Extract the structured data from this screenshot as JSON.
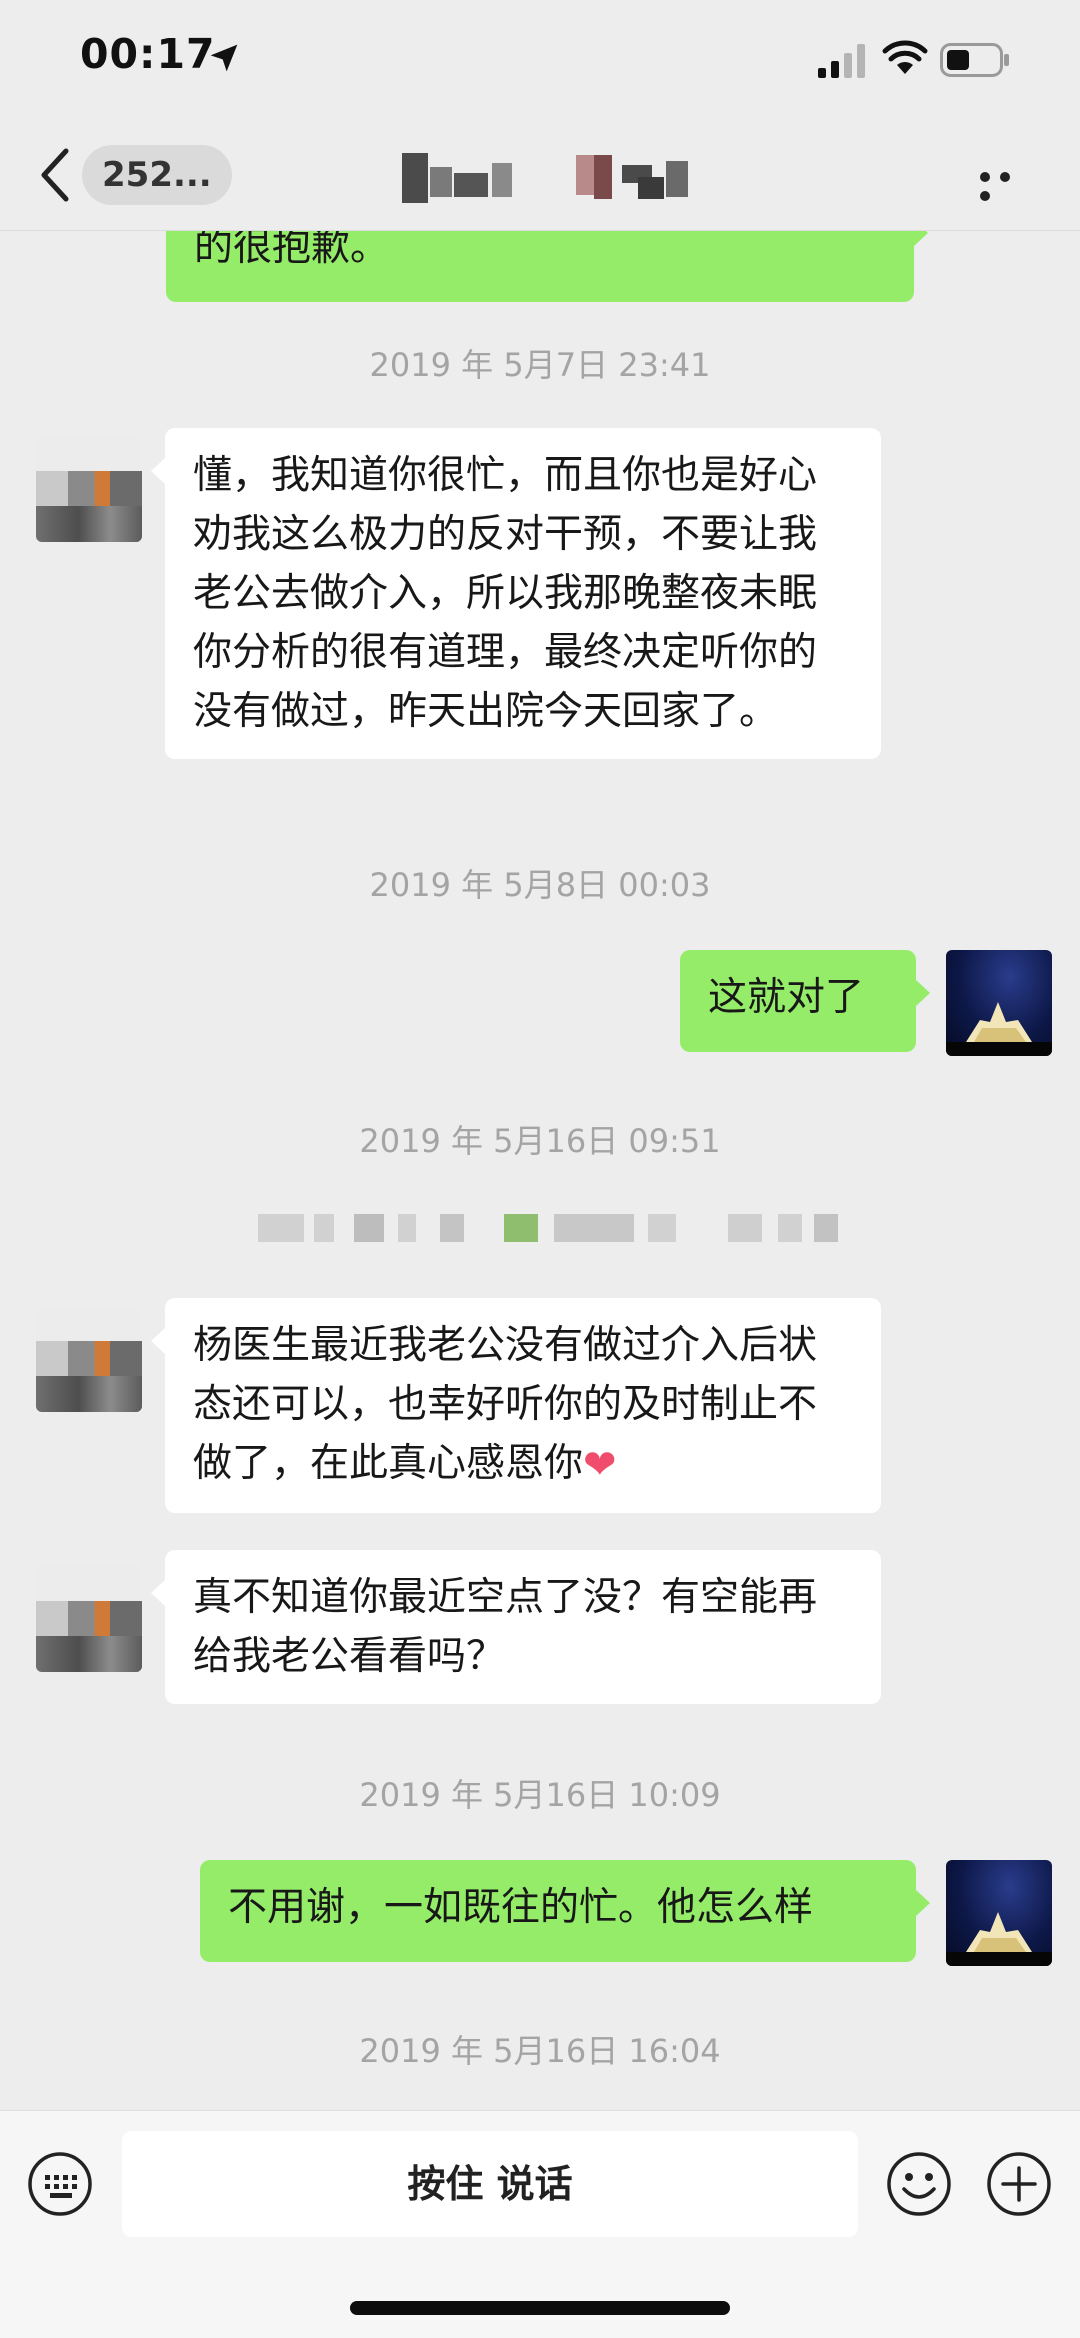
{
  "status_bar": {
    "time": "00:17"
  },
  "nav": {
    "unread_badge": "252..."
  },
  "chat": {
    "partial_message_text": "的很抱歉。",
    "timestamps": [
      "2019 年 5月7日 23:41",
      "2019 年 5月8日 00:03",
      "2019 年 5月16日 09:51",
      "2019 年 5月16日 10:09",
      "2019 年 5月16日 16:04"
    ],
    "messages": [
      {
        "sender": "contact",
        "text": "懂，我知道你很忙，而且你也是好心劝我这么极力的反对干预，不要让我老公去做介入，所以我那晚整夜未眠你分析的很有道理，最终决定听你的没有做过，昨天出院今天回家了。"
      },
      {
        "sender": "self",
        "text": "这就对了"
      },
      {
        "sender": "contact",
        "text": "杨医生最近我老公没有做过介入后状态还可以，也幸好听你的及时制止不做了，在此真心感恩你",
        "emoji": "heart-icon"
      },
      {
        "sender": "contact",
        "text": "真不知道你最近空点了没？有空能再给我老公看看吗？"
      },
      {
        "sender": "self",
        "text": "不用谢，一如既往的忙。他怎么样"
      }
    ]
  },
  "input_bar": {
    "voice_button_label": "按住 说话"
  },
  "colors": {
    "page_background": "#ededed",
    "outgoing_bubble": "#95ec69",
    "incoming_bubble": "#ffffff",
    "timestamp_text": "#a4a4a4"
  },
  "icons": [
    "location-arrow-icon",
    "signal-icon",
    "wifi-icon",
    "battery-icon",
    "back-chevron-icon",
    "more-icon",
    "keyboard-icon",
    "emoji-icon",
    "plus-icon"
  ]
}
